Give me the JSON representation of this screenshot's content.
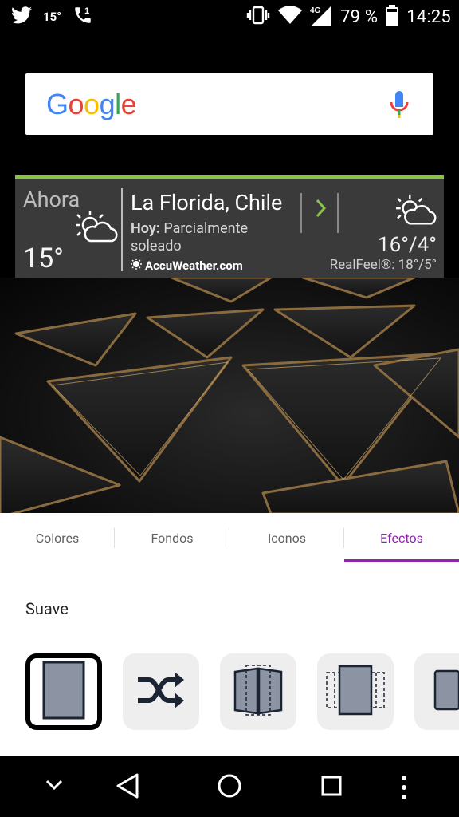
{
  "status_bar": {
    "temperature": "15°",
    "battery_percent": "79 %",
    "time": "14:25",
    "network": "4G"
  },
  "search": {
    "logo_letters": [
      {
        "ch": "G",
        "color": "#4285F4"
      },
      {
        "ch": "o",
        "color": "#EA4335"
      },
      {
        "ch": "o",
        "color": "#FBBC05"
      },
      {
        "ch": "g",
        "color": "#4285F4"
      },
      {
        "ch": "l",
        "color": "#34A853"
      },
      {
        "ch": "e",
        "color": "#EA4335"
      }
    ]
  },
  "weather": {
    "now_label": "Ahora",
    "current_temp": "15°",
    "city": "La Florida, Chile",
    "today_label": "Hoy:",
    "condition": "Parcialmente soleado",
    "brand": "AccuWeather.com",
    "min_max": "16°/4°",
    "realfeel": "RealFeel®: 18°/5°",
    "accent_color": "#8bc34a"
  },
  "tabs": [
    {
      "label": "Colores",
      "active": false
    },
    {
      "label": "Fondos",
      "active": false
    },
    {
      "label": "Iconos",
      "active": false
    },
    {
      "label": "Efectos",
      "active": true
    }
  ],
  "effects_section": {
    "title": "Suave",
    "items": [
      {
        "name": "effect-smooth",
        "selected": true
      },
      {
        "name": "effect-random",
        "selected": false
      },
      {
        "name": "effect-flip",
        "selected": false
      },
      {
        "name": "effect-cube",
        "selected": false
      },
      {
        "name": "effect-zoom",
        "selected": false
      }
    ]
  },
  "accent_color": "#8e24aa"
}
